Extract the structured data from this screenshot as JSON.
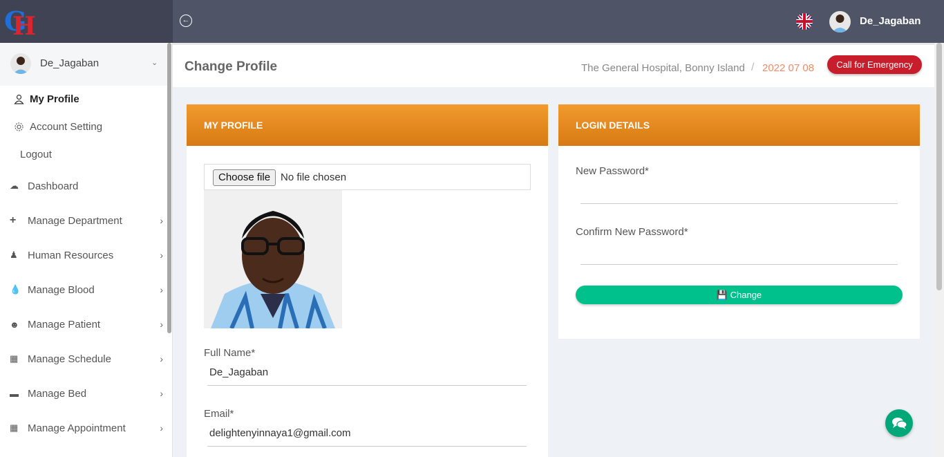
{
  "topbar": {
    "username": "De_Jagaban",
    "icons": {
      "back": "circle-arrow-left-icon",
      "flag": "uk-flag-icon"
    }
  },
  "sidebar": {
    "user": {
      "name": "De_Jagaban"
    },
    "submenu": [
      {
        "label": "My Profile",
        "icon": "user-icon",
        "active": true
      },
      {
        "label": "Account Setting",
        "icon": "gear-icon"
      },
      {
        "label": "Logout"
      }
    ],
    "items": [
      {
        "label": "Dashboard",
        "icon": "speedometer-icon"
      },
      {
        "label": "Manage Department",
        "icon": "plus-icon"
      },
      {
        "label": "Human Resources",
        "icon": "user-doctor-icon"
      },
      {
        "label": "Manage Blood",
        "icon": "blood-drop-icon"
      },
      {
        "label": "Manage Patient",
        "icon": "users-icon"
      },
      {
        "label": "Manage Schedule",
        "icon": "calendar-icon"
      },
      {
        "label": "Manage Bed",
        "icon": "bed-icon"
      },
      {
        "label": "Manage Appointment",
        "icon": "calendar-icon"
      }
    ]
  },
  "header": {
    "title": "Change Profile",
    "hospital": "The General Hospital, Bonny Island",
    "separator": "/",
    "date": "2022 07 08",
    "emergency_label": "Call for Emergency"
  },
  "profile_card": {
    "title": "MY PROFILE",
    "file_button": "Choose file",
    "file_status": "No file chosen",
    "full_name_label": "Full Name*",
    "full_name_value": "De_Jagaban",
    "email_label": "Email*",
    "email_value": "delightenyinnaya1@gmail.com"
  },
  "login_card": {
    "title": "LOGIN DETAILS",
    "new_password_label": "New Password*",
    "confirm_password_label": "Confirm New Password*",
    "change_label": "Change",
    "change_icon": "floppy-disk-icon"
  },
  "colors": {
    "topbar": "#4f5467",
    "card_header": "#ef9227",
    "emergency": "#c81e2b",
    "change_button": "#00c08b",
    "date": "#f18a66"
  }
}
